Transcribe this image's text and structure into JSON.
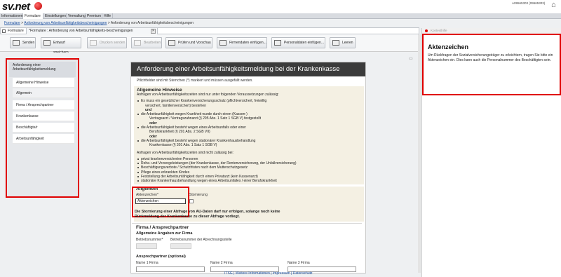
{
  "app": {
    "logo": "sv.net",
    "account": "A09565303 (09565303)"
  },
  "menu": [
    "Informationen",
    "Formulare",
    "Einstellungen",
    "Verwaltung",
    "Premium",
    "Hilfe"
  ],
  "breadcrumb": {
    "root": "Formulare",
    "sep": ">",
    "link": "Anforderung von Arbeitsunfähigkeitsbescheinigungen",
    "current": "Anforderung von Arbeitsunfähigkeitsbescheinigungen"
  },
  "tabs": {
    "first": "Formulare",
    "second": "*Formulare : Anforderung von Arbeitsunfähigkeits-bescheinigungen"
  },
  "toolbar": {
    "senden": "Senden",
    "entwurf": "Entwurf speichern",
    "drucken": "Drucken senden",
    "bearbeiten": "Bearbeiten",
    "pruefen": "Prüfen und Vorschau",
    "firmendaten": "Firmendaten einfügen...",
    "personaldaten": "Personaldaten einfügen...",
    "leeren": "Leeren"
  },
  "nav": {
    "title": "Anforderung einer Arbeitsunfähigkeitsmeldung",
    "items": [
      "Allgemeine Hinweise",
      "Allgemein",
      "Firma / Ansprechpartner",
      "Krankenkasse",
      "Beschäftigte/r",
      "Arbeitsunfähigkeit"
    ]
  },
  "form": {
    "title": "Anforderung einer Arbeitsunfähigkeitsmeldung bei der Krankenkasse",
    "note": "Pflichtfelder sind mit Sternchen (*) markiert und müssen ausgefüllt werden.",
    "hinweise": {
      "heading": "Allgemeine Hinweise",
      "intro": "Anfragen von Arbeitsunfähigkeitszeiten sind nur unter folgenden Voraussetzungen zulässig:",
      "b1": "Es muss ein gesetzlicher Krankenversicherungsschutz (pflichtversichert, freiwillig",
      "b1b": "versichert, familienversichert) bestehen",
      "und": "und",
      "s1": "die Arbeitsunfähigkeit wegen Krankheit wurde durch einen (Kassen-)",
      "s1b": "Vertragsarzt / Vertragszahnarzt (§ 295 Abs. 1 Satz 1 SGB V) festgestellt",
      "oder": "oder",
      "s2": "die Arbeitsunfähigkeit besteht wegen eines Arbeitsunfalls oder einer",
      "s2b": "Berufskrankheit (§ 201 Abs. 2 SGB VII)",
      "s3": "die Arbeitsunfähigkeit besteht wegen stationärer Krankenhausbehandlung",
      "s3b": "Krankenkasse (§ 301 Abs. 1 Satz 1 SGB V)",
      "nicht": "Anfragen von Arbeitsunfähigkeitszeiten sind nicht zulässig bei:",
      "list": [
        "privat krankenversicherten Personen",
        "Reha- und Vorsorgeleistungen (der Krankenkasse, der Rentenversicherung, der Unfallversicherung)",
        "Beschäftigungsverbote / Schutzfristen nach dem Mutterschutzgesetz",
        "Pflege eines erkrankten Kindes",
        "Feststellung der Arbeitsunfähigkeit durch einen Privatarzt (kein Kassenarzt)",
        "stationäre Krankenhausbehandlung wegen eines Arbeitsunfalles / einer Berufskrankheit"
      ]
    },
    "allgemein": {
      "heading": "Allgemein",
      "aktenzeichen_label": "Aktenzeichen*",
      "aktenzeichen_value": "Aktenzeichen",
      "stornierung": "Stornierung",
      "warn1": "Die Stornierung einer Abfrage von AU-Daten darf nur erfolgen, solange noch keine",
      "warn2": "Rückmeldung der Krankenkasse zu dieser Abfrage vorliegt."
    },
    "firma": {
      "heading": "Firma / Ansprechpartner",
      "sub": "Allgemeine Angaben zur Firma",
      "betriebsnummer": "Betriebsnummer*",
      "betriebsnummer2": "Betriebsnummer der Abrechnungsstelle",
      "ansprech": "Ansprechpartner (optional)",
      "name1": "Name 1 Firma",
      "name2": "Name 2 Firma",
      "name3": "Name 3 Firma"
    }
  },
  "help": {
    "header": "Kontexthilfe",
    "title": "Aktenzeichen",
    "text": "Um Rückfragen der Sozialversicherungsträger zu erleichtern, tragen Sie bitte ein Aktenzeichen ein. Dies kann auch die Personalnummer des Beschäftigten sein."
  },
  "footer": "ITSG | Weitere Informationen | Impressum | Datenschutz",
  "colors": {
    "accent": "#e00000",
    "title_bar": "#3b3b3b",
    "link": "#1a4fa0",
    "section_bg": "#f4f0e3"
  }
}
